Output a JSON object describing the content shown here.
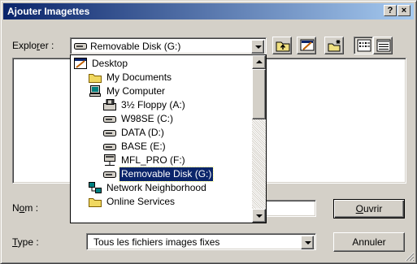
{
  "window": {
    "title": "Ajouter Imagettes",
    "help_label": "?",
    "close_label": "×"
  },
  "explorer": {
    "label_before": "Explo",
    "label_accel": "r",
    "label_after": "er :",
    "current": "Removable Disk (G:)"
  },
  "toolbar": {
    "icons": [
      "up-one-level-icon",
      "desktop-icon",
      "new-folder-icon",
      "list-view-icon",
      "details-view-icon"
    ]
  },
  "dropdown": {
    "items": [
      {
        "label": "Desktop",
        "icon": "desktop-icon",
        "level": 0
      },
      {
        "label": "My Documents",
        "icon": "folder-icon",
        "level": 1
      },
      {
        "label": "My Computer",
        "icon": "computer-icon",
        "level": 1
      },
      {
        "label": "3½ Floppy (A:)",
        "icon": "floppy-icon",
        "level": 2
      },
      {
        "label": "W98SE (C:)",
        "icon": "drive-icon",
        "level": 2
      },
      {
        "label": "DATA (D:)",
        "icon": "drive-icon",
        "level": 2
      },
      {
        "label": "BASE (E:)",
        "icon": "drive-icon",
        "level": 2
      },
      {
        "label": "MFL_PRO (F:)",
        "icon": "network-drive-icon",
        "level": 2
      },
      {
        "label": "Removable Disk (G:)",
        "icon": "drive-icon",
        "level": 2,
        "selected": true
      },
      {
        "label": "Network Neighborhood",
        "icon": "network-icon",
        "level": 1
      },
      {
        "label": "Online Services",
        "icon": "folder-icon",
        "level": 1
      }
    ]
  },
  "form": {
    "name_label_before": "N",
    "name_label_accel": "o",
    "name_label_after": "m :",
    "name_value": "",
    "type_label_accel": "T",
    "type_label_after": "ype :",
    "type_value": "Tous les fichiers images fixes"
  },
  "buttons": {
    "open_accel": "O",
    "open_rest": "uvrir",
    "cancel": "Annuler"
  }
}
